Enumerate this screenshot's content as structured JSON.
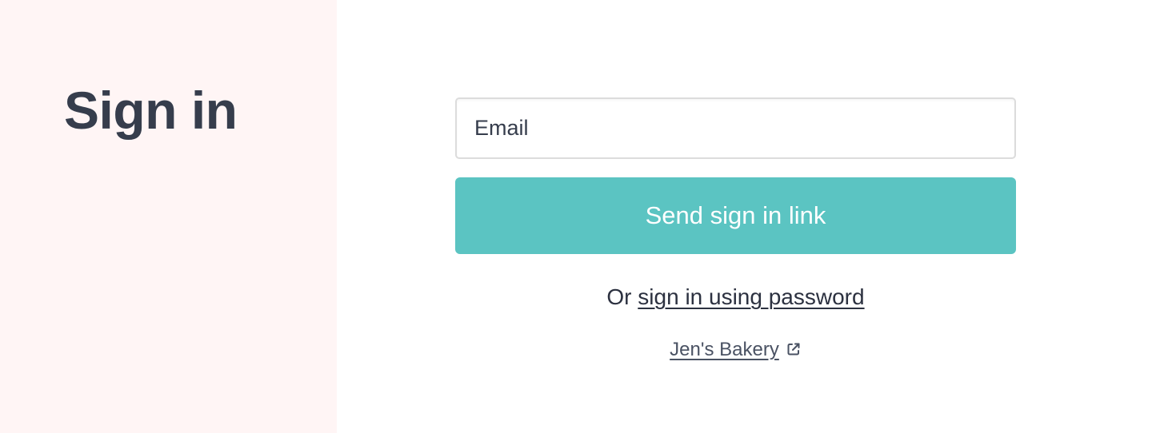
{
  "side_panel": {
    "title": "Sign in",
    "background": "#fff5f5"
  },
  "form": {
    "email": {
      "placeholder": "Email",
      "value": ""
    },
    "submit_label": "Send sign in link",
    "submit_color": "#5bc4c2",
    "alt_prefix": "Or ",
    "alt_link_label": "sign in using password"
  },
  "footer": {
    "shop_link_label": "Jen's Bakery",
    "shop_link_icon": "external-link-icon"
  }
}
